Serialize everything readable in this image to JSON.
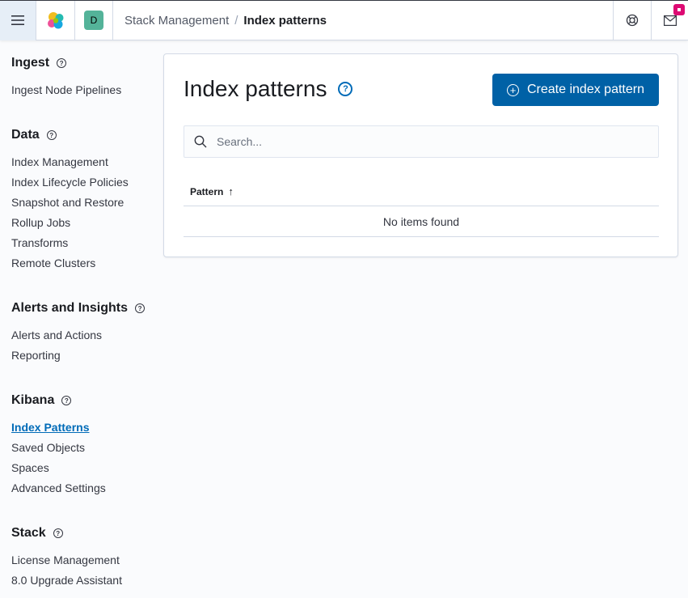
{
  "header": {
    "space_initial": "D",
    "breadcrumbs": {
      "parent": "Stack Management",
      "separator": "/",
      "current": "Index patterns"
    }
  },
  "sidebar": {
    "groups": [
      {
        "title": "Ingest",
        "items": [
          "Ingest Node Pipelines"
        ]
      },
      {
        "title": "Data",
        "items": [
          "Index Management",
          "Index Lifecycle Policies",
          "Snapshot and Restore",
          "Rollup Jobs",
          "Transforms",
          "Remote Clusters"
        ]
      },
      {
        "title": "Alerts and Insights",
        "items": [
          "Alerts and Actions",
          "Reporting"
        ]
      },
      {
        "title": "Kibana",
        "items": [
          "Index Patterns",
          "Saved Objects",
          "Spaces",
          "Advanced Settings"
        ]
      },
      {
        "title": "Stack",
        "items": [
          "License Management",
          "8.0 Upgrade Assistant"
        ]
      }
    ],
    "active_item": "Index Patterns"
  },
  "main": {
    "title": "Index patterns",
    "create_button_label": "Create index pattern",
    "search_placeholder": "Search...",
    "table": {
      "column_header": "Pattern",
      "sort_indicator": "↑",
      "empty_message": "No items found"
    }
  },
  "colors": {
    "accent": "#0061a6",
    "link_active": "#006bb8",
    "notification": "#dd0a73",
    "space_avatar": "#54b399"
  },
  "icons": [
    "menu-icon",
    "elastic-logo-icon",
    "help-icon",
    "newsfeed-icon",
    "question-icon",
    "plus-circle-icon",
    "search-icon",
    "sort-ascending-icon"
  ]
}
